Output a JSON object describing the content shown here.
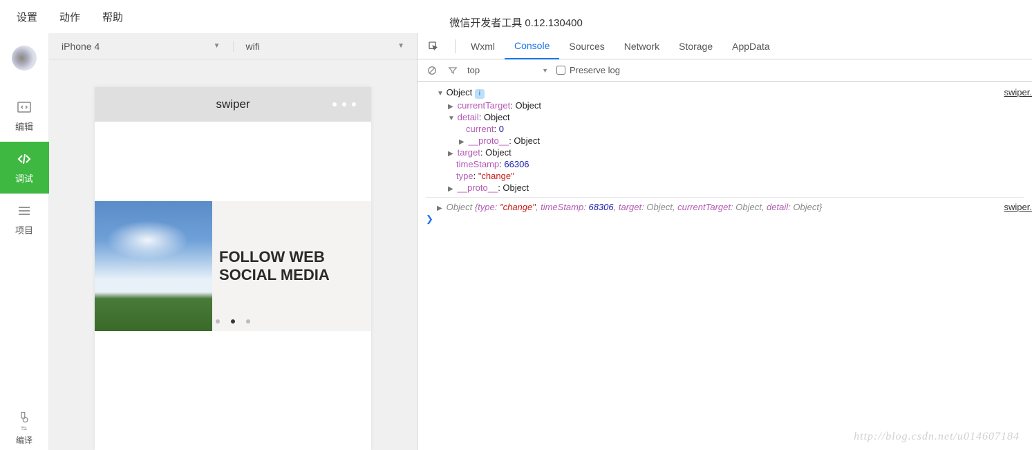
{
  "menubar": {
    "settings": "设置",
    "actions": "动作",
    "help": "帮助"
  },
  "title": "微信开发者工具 0.12.130400",
  "sidebar": {
    "edit": "编辑",
    "debug": "调试",
    "project": "项目",
    "compile": "编译"
  },
  "simulator": {
    "device": "iPhone 4",
    "network": "wifi",
    "page_title": "swiper",
    "slide2_text": "FOLLOW WEB SOCIAL MEDIA"
  },
  "devtools": {
    "tabs": [
      "Wxml",
      "Console",
      "Sources",
      "Network",
      "Storage",
      "AppData"
    ],
    "active_tab": "Console",
    "filter_scope": "top",
    "preserve_label": "Preserve log",
    "source_link": "swiper.",
    "log1": {
      "root": "Object",
      "currentTarget_k": "currentTarget",
      "currentTarget_v": "Object",
      "detail_k": "detail",
      "detail_v": "Object",
      "current_k": "current",
      "current_v": "0",
      "proto_k": "__proto__",
      "proto_v": "Object",
      "target_k": "target",
      "target_v": "Object",
      "timeStamp_k": "timeStamp",
      "timeStamp_v": "66306",
      "type_k": "type",
      "type_v": "\"change\""
    },
    "log2": {
      "head": "Object ",
      "type_k": "type",
      "type_v": "\"change\"",
      "ts_k": "timeStamp",
      "ts_v": "68306",
      "target_k": "target",
      "target_v": "Object",
      "ct_k": "currentTarget",
      "ct_v": "Object",
      "detail_k": "detail",
      "detail_v": "Object"
    }
  },
  "watermark": "http://blog.csdn.net/u014607184"
}
